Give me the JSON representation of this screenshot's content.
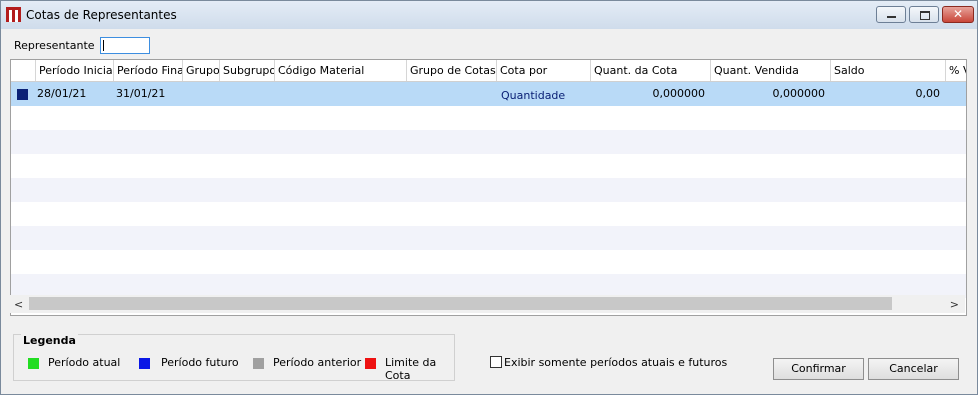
{
  "window": {
    "title": "Cotas de Representantes"
  },
  "filter": {
    "label": "Representante",
    "value": ""
  },
  "grid": {
    "columns": [
      "Período Inicial",
      "Período Final",
      "Grupo",
      "Subgrupo",
      "Código Material",
      "Grupo de Cotas",
      "Cota por",
      "Quant. da Cota",
      "Quant. Vendida",
      "Saldo",
      "% V"
    ],
    "rows": [
      {
        "periodo_inicial": "28/01/21",
        "periodo_final": "31/01/21",
        "grupo": "",
        "subgrupo": "",
        "codigo_material": "",
        "grupo_cotas": "",
        "cota_por": "Quantidade",
        "quant_cota": "0,000000",
        "quant_vendida": "0,000000",
        "saldo": "0,00",
        "pct_v": "",
        "status_color": "#0b2176"
      }
    ]
  },
  "legend": {
    "title": "Legenda",
    "items": [
      {
        "label": "Período atual",
        "color": "#22dd22"
      },
      {
        "label": "Período futuro",
        "color": "#0a17e6"
      },
      {
        "label": "Período anterior",
        "color": "#a0a0a0"
      },
      {
        "label": "Limite da Cota",
        "color": "#ee1111"
      }
    ]
  },
  "options": {
    "only_current_future_label": "Exibir somente períodos atuais e futuros",
    "only_current_future_checked": false
  },
  "buttons": {
    "confirm": "Confirmar",
    "cancel": "Cancelar"
  }
}
